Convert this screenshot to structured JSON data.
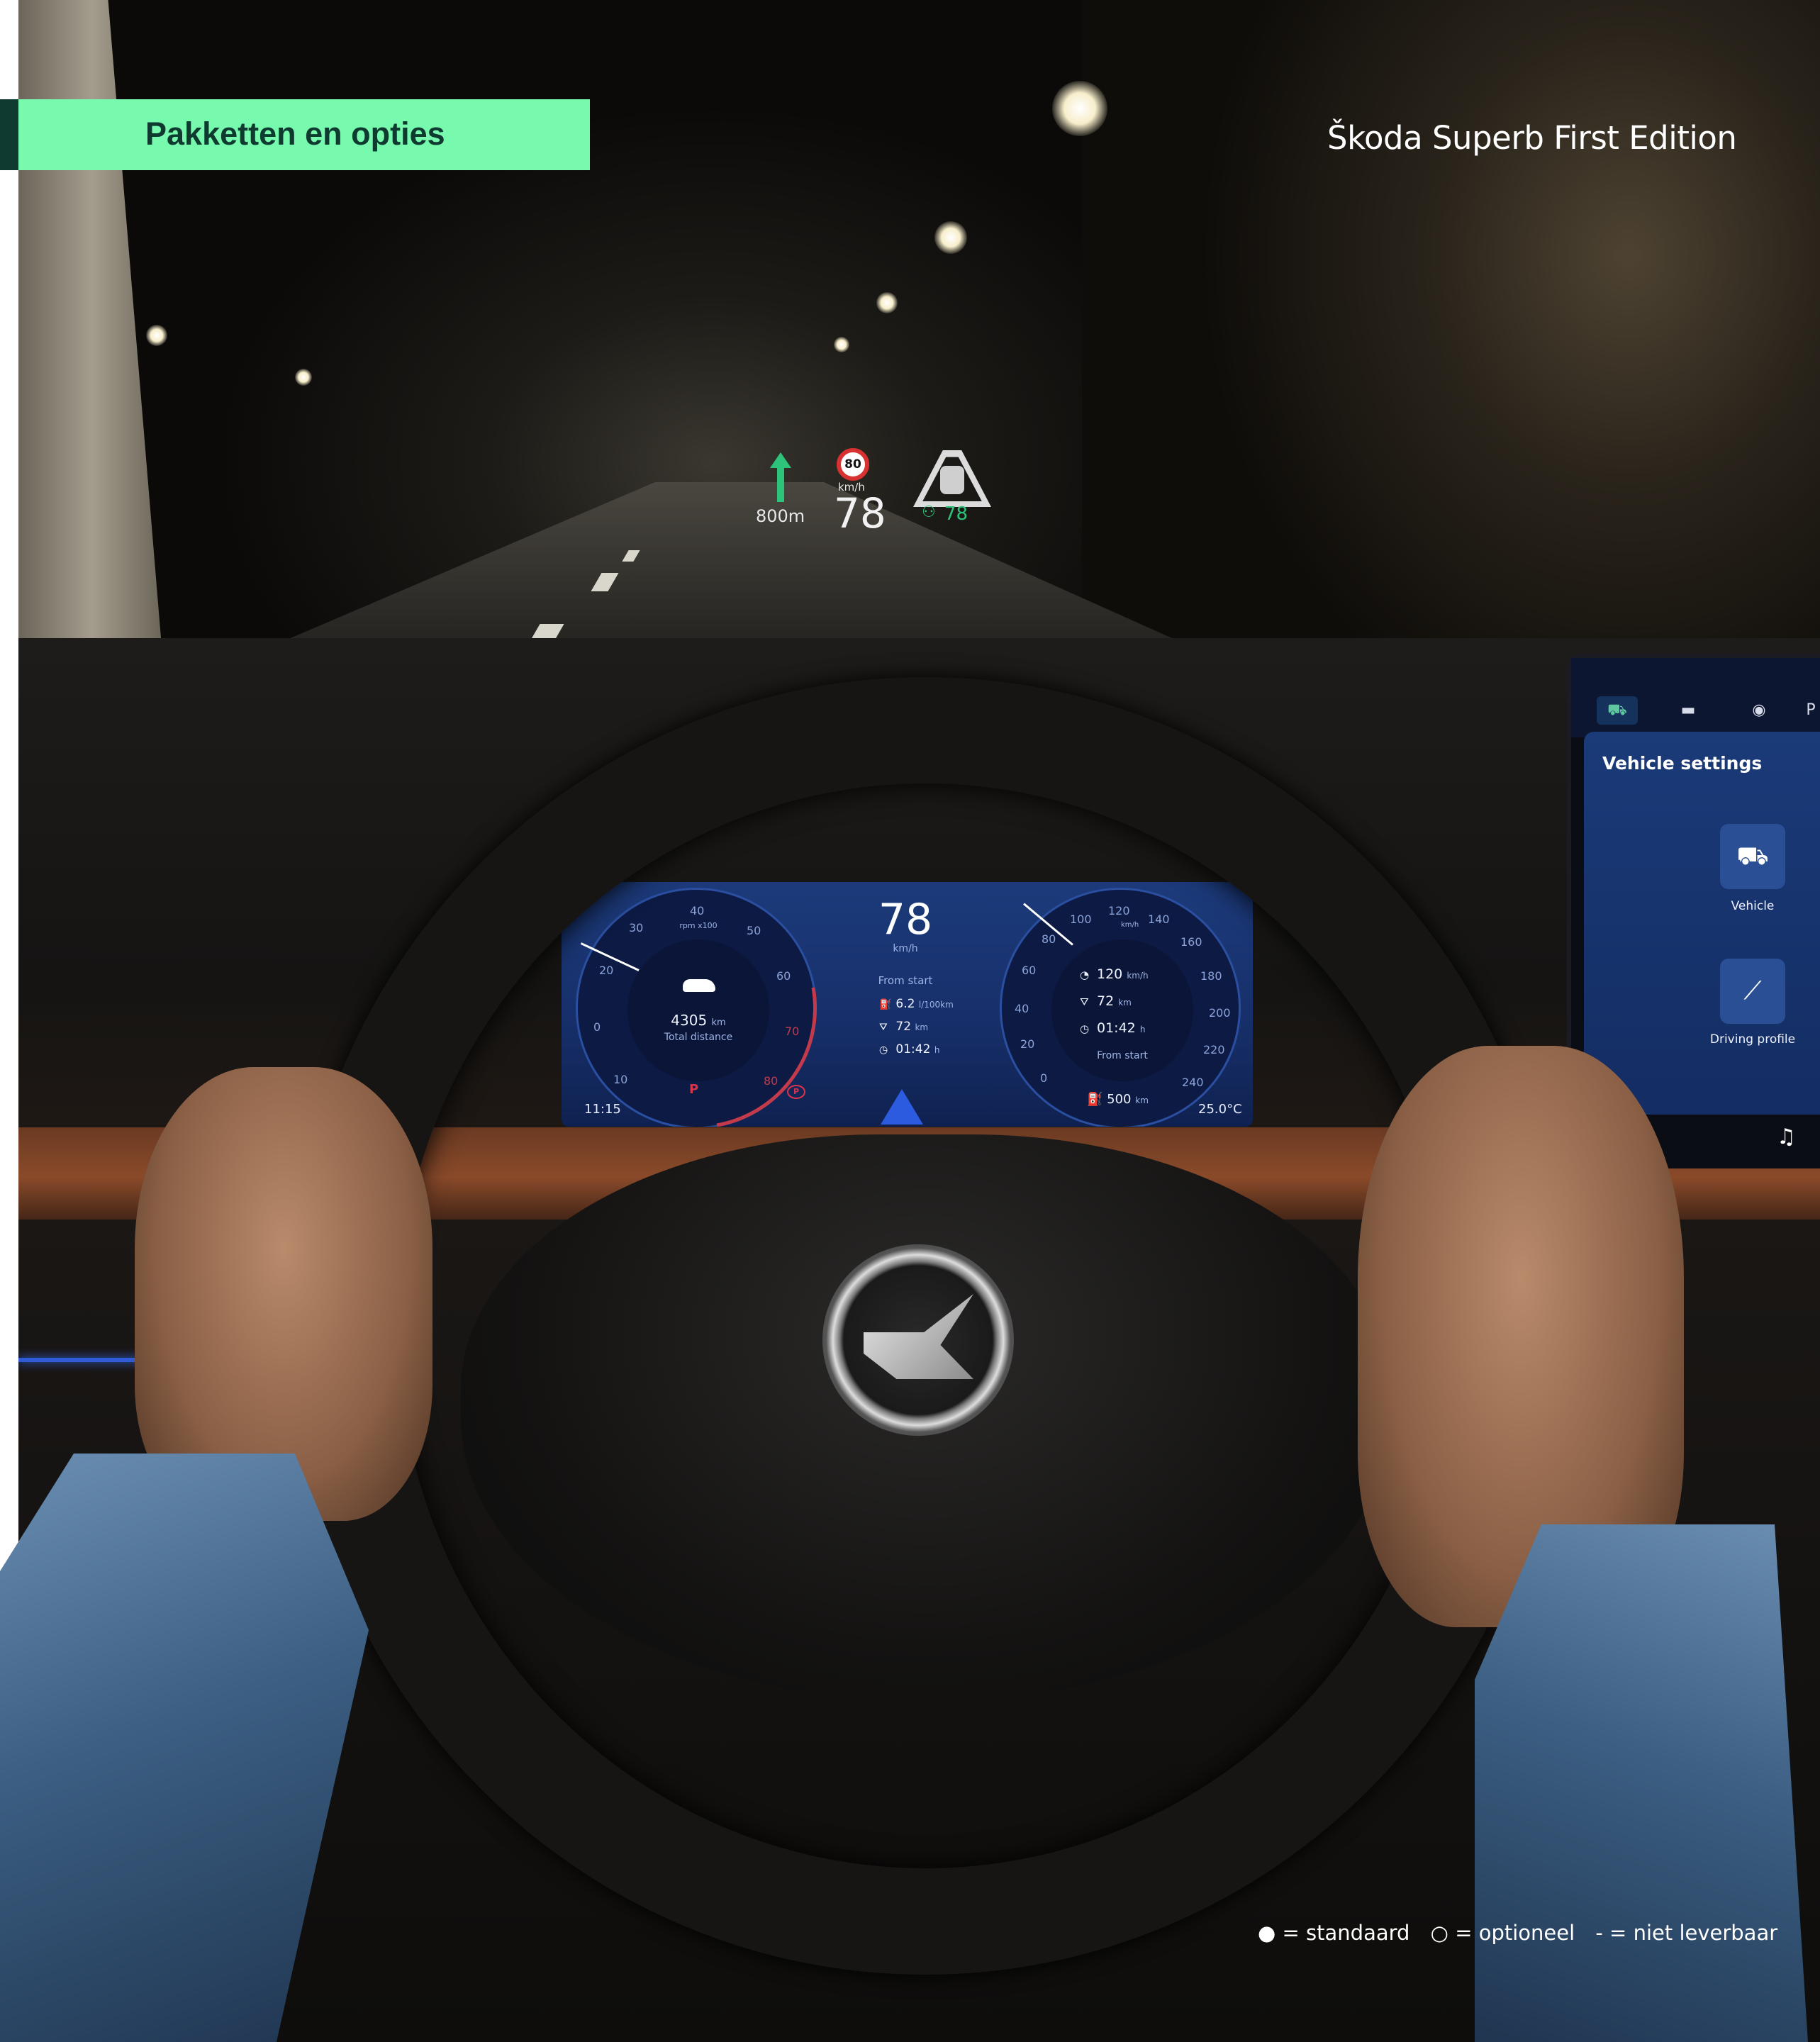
{
  "header": {
    "section_title": "Pakketten en opties",
    "model_title": "Škoda Superb First Edition",
    "accent_color": "#78faae",
    "accent_text_color": "#0e3a2f"
  },
  "legend": {
    "standard": "● = standaard",
    "optional": "○ = optioneel",
    "not_available": "- = niet leverbaar"
  },
  "hud": {
    "distance": "800m",
    "speed_limit": "80",
    "unit": "km/h",
    "speed": "78",
    "acc_speed": "78"
  },
  "cluster": {
    "speed": "78",
    "speed_unit": "km/h",
    "from_start_label": "From start",
    "consumption": "6.2",
    "consumption_unit": "l/100km",
    "trip_distance": "72",
    "trip_distance_unit": "km",
    "trip_time": "01:42",
    "trip_time_unit": "h",
    "time": "11:15",
    "temperature": "25.0°C",
    "gear": "P",
    "rpm_label": "rpm x100",
    "rpm_ticks": [
      "0",
      "10",
      "20",
      "30",
      "40",
      "50",
      "60",
      "70",
      "80"
    ],
    "odometer": "4305",
    "odometer_unit": "km",
    "odometer_label": "Total distance",
    "speed_ticks": [
      "0",
      "20",
      "40",
      "60",
      "80",
      "100",
      "120",
      "140",
      "160",
      "180",
      "200",
      "220",
      "240"
    ],
    "speed_gauge_unit": "km/h",
    "acc_set_speed": "120",
    "acc_unit": "km/h",
    "right_distance": "72",
    "right_distance_unit": "km",
    "right_time": "01:42",
    "right_time_unit": "h",
    "right_from_start": "From start",
    "range": "500",
    "range_unit": "km"
  },
  "infotainment": {
    "tabs": [
      {
        "icon": "car-icon",
        "active": true
      },
      {
        "icon": "battery-icon",
        "active": false
      },
      {
        "icon": "assist-icon",
        "active": false
      },
      {
        "icon": "parking-icon",
        "active": false
      }
    ],
    "panel_title": "Vehicle settings",
    "tiles": [
      {
        "icon": "car-icon",
        "label": "Vehicle"
      },
      {
        "icon": "driving-profile-icon",
        "label": "Driving profile"
      }
    ]
  }
}
